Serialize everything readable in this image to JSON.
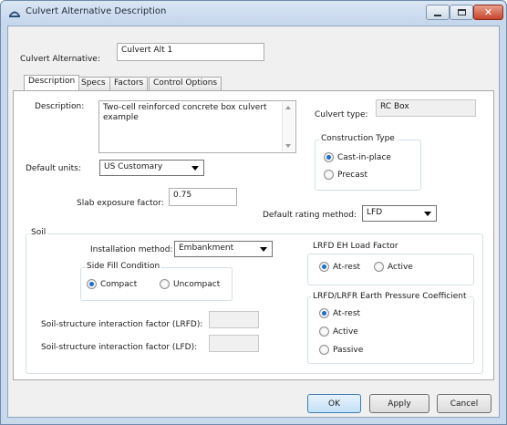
{
  "window": {
    "title": "Culvert Alternative Description",
    "icon": "bridge-icon",
    "controls": {
      "minimize": "minimize-icon",
      "maximize": "maximize-icon",
      "close": "close-icon"
    }
  },
  "header": {
    "alt_label": "Culvert Alternative:",
    "alt_value": "Culvert Alt 1"
  },
  "tabs": [
    {
      "label": "Description",
      "selected": true
    },
    {
      "label": "Specs",
      "selected": false
    },
    {
      "label": "Factors",
      "selected": false
    },
    {
      "label": "Control Options",
      "selected": false
    }
  ],
  "description": {
    "label": "Description:",
    "value": "Two-cell reinforced concrete box culvert example"
  },
  "culvert_type": {
    "label": "Culvert type:",
    "value": "RC Box"
  },
  "construction_type": {
    "title": "Construction Type",
    "options": [
      {
        "label": "Cast-in-place",
        "checked": true
      },
      {
        "label": "Precast",
        "checked": false
      }
    ]
  },
  "default_units": {
    "label": "Default units:",
    "value": "US Customary"
  },
  "slab_exposure": {
    "label": "Slab exposure factor:",
    "value": "0.75"
  },
  "rating_method": {
    "label": "Default rating method:",
    "value": "LFD"
  },
  "soil": {
    "title": "Soil",
    "installation_label": "Installation method:",
    "installation_value": "Embankment",
    "side_fill": {
      "title": "Side Fill Condition",
      "options": [
        {
          "label": "Compact",
          "checked": true
        },
        {
          "label": "Uncompact",
          "checked": false
        }
      ]
    },
    "ssi_lrfd_label": "Soil-structure interaction factor (LRFD):",
    "ssi_lrfd_value": "",
    "ssi_lfd_label": "Soil-structure interaction factor (LFD):",
    "ssi_lfd_value": "",
    "eh_load": {
      "title": "LRFD EH Load Factor",
      "options": [
        {
          "label": "At-rest",
          "checked": true
        },
        {
          "label": "Active",
          "checked": false
        }
      ]
    },
    "earth_pressure": {
      "title": "LRFD/LRFR Earth Pressure Coefficient",
      "options": [
        {
          "label": "At-rest",
          "checked": true
        },
        {
          "label": "Active",
          "checked": false
        },
        {
          "label": "Passive",
          "checked": false
        }
      ]
    }
  },
  "buttons": {
    "ok": "OK",
    "apply": "Apply",
    "cancel": "Cancel"
  }
}
